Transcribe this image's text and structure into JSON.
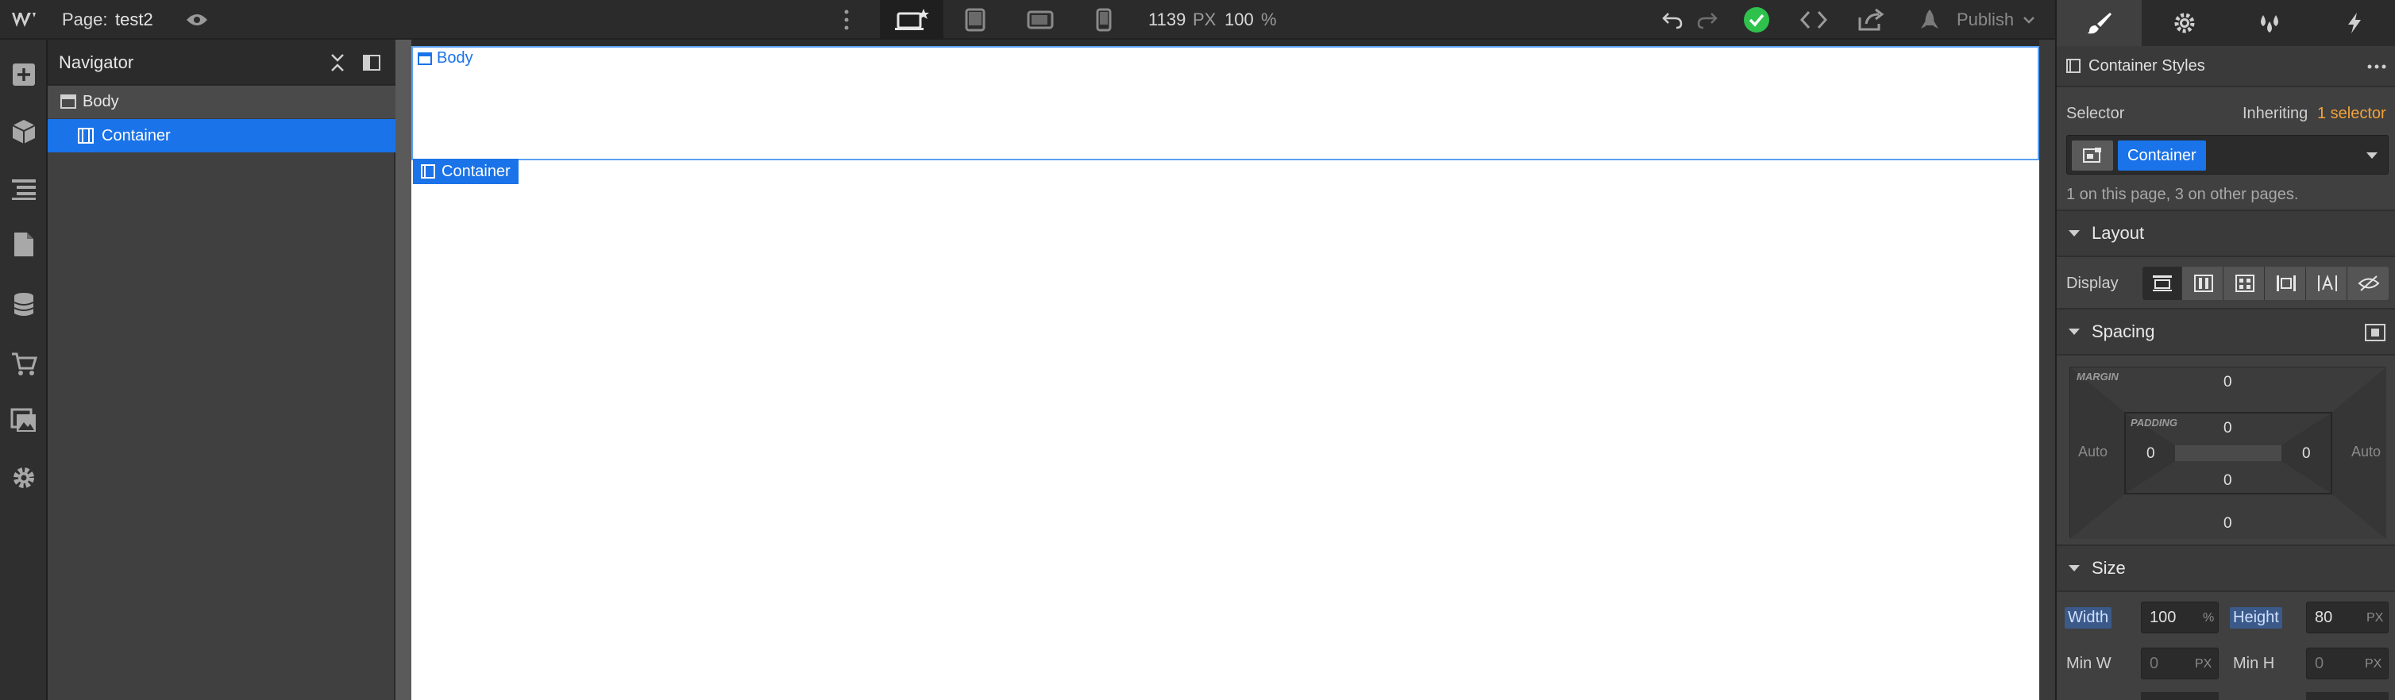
{
  "topbar": {
    "page_label": "Page:",
    "page_name": "test2",
    "width_value": "1139",
    "width_unit": "PX",
    "zoom_value": "100",
    "zoom_unit": "%",
    "publish_label": "Publish"
  },
  "navigator": {
    "title": "Navigator",
    "items": [
      {
        "label": "Body",
        "selected": false
      },
      {
        "label": "Container",
        "selected": true
      }
    ]
  },
  "canvas": {
    "body_tag": "Body",
    "container_tag": "Container"
  },
  "style_panel": {
    "header_title": "Container Styles",
    "selector_label": "Selector",
    "inheriting_label": "Inheriting",
    "inheriting_link": "1 selector",
    "selector_chip": "Container",
    "selector_info": "1 on this page, 3 on other pages.",
    "layout": {
      "title": "Layout",
      "display_label": "Display"
    },
    "spacing": {
      "title": "Spacing",
      "margin_label": "MARGIN",
      "padding_label": "PADDING",
      "margin_top": "0",
      "margin_bottom": "0",
      "margin_left": "Auto",
      "margin_right": "Auto",
      "padding_top": "0",
      "padding_bottom": "0",
      "padding_left": "0",
      "padding_right": "0"
    },
    "size": {
      "title": "Size",
      "width_label": "Width",
      "width_value": "100",
      "width_unit": "%",
      "height_label": "Height",
      "height_value": "80",
      "height_unit": "PX",
      "min_w_label": "Min W",
      "min_w_value": "0",
      "min_w_unit": "PX",
      "min_h_label": "Min H",
      "min_h_value": "0",
      "min_h_unit": "PX"
    }
  },
  "colors": {
    "accent_blue": "#1a73e8",
    "success_green": "#2ec24d",
    "link_orange": "#f2a23a"
  }
}
